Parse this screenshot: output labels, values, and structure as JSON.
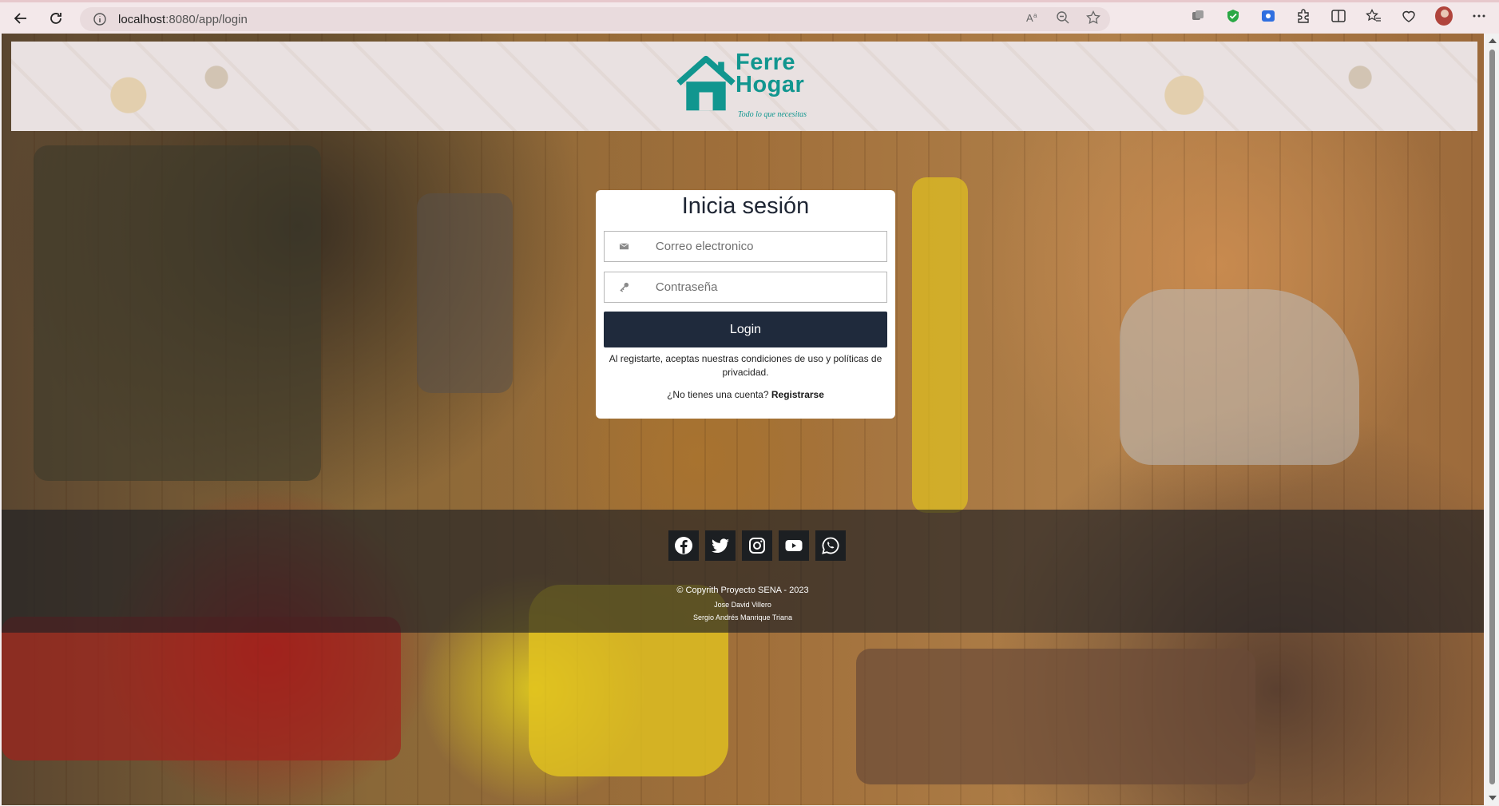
{
  "browser": {
    "url_host": "localhost",
    "url_path": ":8080/app/login",
    "icons": [
      "back-icon",
      "refresh-icon",
      "info-icon",
      "read-aloud-icon",
      "zoom-out-icon",
      "favorite-star-icon",
      "collections-icon",
      "shield-extension-icon",
      "screen-cast-icon",
      "extensions-icon",
      "split-screen-icon",
      "favorites-icon",
      "performance-icon",
      "profile-avatar",
      "more-icon"
    ]
  },
  "header": {
    "logo_line1": "Ferre",
    "logo_line2": "Hogar",
    "tagline": "Todo lo que necesitas",
    "brand_color": "#11968f"
  },
  "login": {
    "title": "Inicia sesión",
    "email_placeholder": "Correo electronico",
    "password_placeholder": "Contraseña",
    "button_label": "Login",
    "terms": "Al registarte, aceptas nuestras condiciones de uso y políticas de privacidad.",
    "no_account": "¿No tienes una cuenta?",
    "register_label": "Registrarse",
    "button_color": "#1f2a3c"
  },
  "footer": {
    "socials": [
      "facebook-icon",
      "twitter-icon",
      "instagram-icon",
      "youtube-icon",
      "whatsapp-icon"
    ],
    "copyright": "© Copyrith Proyecto SENA - 2023",
    "author1": "Jose David Villero",
    "author2": "Sergio Andrés Manrique Triana"
  }
}
